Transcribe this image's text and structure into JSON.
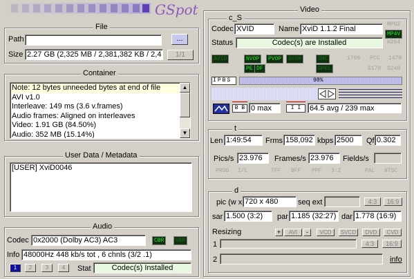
{
  "logo": {
    "text": "GSpot"
  },
  "file": {
    "title": "File",
    "path_label": "Path",
    "path_value": "",
    "browse_label": "...",
    "size_label": "Size",
    "size_value": "2.27 GB (2,325 MB / 2,381,382 KB / 2,4",
    "part_label": "1/1"
  },
  "container": {
    "title": "Container",
    "lines": [
      "Note: 12 bytes unneeded bytes at end of file",
      "AVI v1.0",
      "Interleave: 149 ms (3.6 v.frames)",
      "Audio frames: Aligned on interleaves",
      "Video: 1.91 GB (84.50%)",
      "Audio: 352 MB (15.14%)"
    ]
  },
  "userdata": {
    "title": "User Data / Metadata",
    "lines": [
      "[USER]    XviD0046"
    ]
  },
  "audio": {
    "title": "Audio",
    "codec_label": "Codec",
    "codec_value": "0x2000 (Dolby AC3) AC3",
    "cbr": "CBR",
    "vbr": "VBR",
    "info_label": "Info",
    "info_value": "48000Hz  448 kb/s tot , 6 chnls (3/2 .1)",
    "streams": [
      "1",
      "2",
      "3",
      "4"
    ],
    "stat_label": "Stat",
    "stat_value": "Codec(s) Installed"
  },
  "video": {
    "title": "Video",
    "cs": {
      "title": "c_S",
      "codec_label": "Codec",
      "codec_value": "XVID",
      "name_label": "Name",
      "name_value": "XviD 1.1.2 Final",
      "status_label": "Status",
      "status_value": "Codec(s) are Installed",
      "formats": [
        "MPG2",
        "MP4V",
        "H264"
      ],
      "flags_row1": [
        "AVID",
        "NVOP",
        "PVOP",
        "SVOP",
        "SMC"
      ],
      "flags_row2": [
        "PE",
        "DF",
        "OPEL"
      ],
      "standards": [
        "1709",
        "PCC",
        "1470",
        "S170",
        "S240"
      ],
      "frame_types": [
        "I",
        "P",
        "B",
        "S"
      ],
      "percent": "98%",
      "b_value": "0 max",
      "i_value": "64.5 avg / 239 max"
    },
    "t": {
      "title": "t",
      "len_label": "Len",
      "len_value": "1:49:54",
      "frms_label": "Frms",
      "frms_value": "158,092",
      "kbps_label": "kbps",
      "kbps_value": "2500",
      "qf_label": "Qf",
      "qf_value": "0.302",
      "pics_label": "Pics/s",
      "pics_value": "23.976",
      "frames_label": "Frames/s",
      "frames_value": "23.976",
      "fields_label": "Fields/s",
      "fields_value": "",
      "tags": [
        "PROG",
        "I/L",
        "TFF",
        "BFF",
        "PPF",
        "3:2",
        "PAL",
        "NTSC"
      ]
    },
    "d": {
      "title": "d",
      "pic_label": "pic (w x",
      "pic_value": "720 x 480",
      "seq_label": "seq ext",
      "seq_value": "",
      "ar1": "4:3",
      "ar2": "16:9",
      "sar_label": "sar",
      "sar_value": "1.500 (3:2)",
      "par_label": "par",
      "par_value": "1.185 (32:27)",
      "dar_label": "dar",
      "dar_value": "1.778 (16:9)",
      "resizing_label": "Resizing",
      "resize_buttons": [
        "+",
        "AVI",
        "-",
        "VCD",
        "SVCD",
        "DVD",
        "CVD"
      ],
      "row1_label": "1",
      "row2_label": "2",
      "info_link": "info"
    }
  }
}
